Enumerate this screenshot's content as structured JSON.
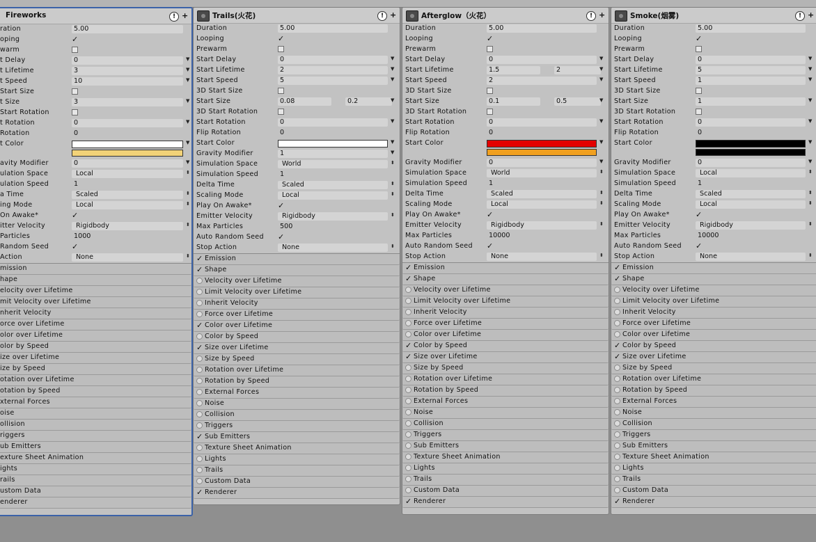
{
  "colors": {
    "panel_bg": "#c2c2c2",
    "selected_border": "#3b62a8",
    "background": "#8f8f8f"
  },
  "check_glyph": "✓",
  "panels": [
    {
      "title": "Fireworks",
      "selected": true,
      "props": [
        {
          "label": "ration",
          "type": "field",
          "value": "5.00"
        },
        {
          "label": "oping",
          "type": "check",
          "checked": true
        },
        {
          "label": "warm",
          "type": "check",
          "checked": false
        },
        {
          "label": "t Delay",
          "type": "field",
          "value": "0",
          "dropdown": true
        },
        {
          "label": "t Lifetime",
          "type": "field",
          "value": "3",
          "dropdown": true
        },
        {
          "label": "t Speed",
          "type": "field",
          "value": "10",
          "dropdown": true
        },
        {
          "label": "Start Size",
          "type": "check",
          "checked": false
        },
        {
          "label": "t Size",
          "type": "field",
          "value": "3",
          "dropdown": true
        },
        {
          "label": "Start Rotation",
          "type": "check",
          "checked": false
        },
        {
          "label": "t Rotation",
          "type": "field",
          "value": "0",
          "dropdown": true
        },
        {
          "label": "Rotation",
          "type": "field",
          "value": "0",
          "plain": true
        },
        {
          "label": "t Color",
          "type": "color",
          "colors": [
            "#ffffff",
            "#f2d278"
          ],
          "dropdown": true
        },
        {
          "label": "avity Modifier",
          "type": "field",
          "value": "0",
          "dropdown": true
        },
        {
          "label": "ulation Space",
          "type": "select",
          "value": "Local"
        },
        {
          "label": "ulation Speed",
          "type": "field",
          "value": "1",
          "plain": true
        },
        {
          "label": "a Time",
          "type": "select",
          "value": "Scaled"
        },
        {
          "label": "ing Mode",
          "type": "select",
          "value": "Local"
        },
        {
          "label": "On Awake*",
          "type": "check",
          "checked": true
        },
        {
          "label": "itter Velocity",
          "type": "select",
          "value": "Rigidbody"
        },
        {
          "label": "Particles",
          "type": "field",
          "value": "1000",
          "plain": true
        },
        {
          "label": "Random Seed",
          "type": "check",
          "checked": true
        },
        {
          "label": "Action",
          "type": "select",
          "value": "None"
        }
      ],
      "modules": [
        {
          "label": "mission",
          "state": "none"
        },
        {
          "label": "hape",
          "state": "none"
        },
        {
          "label": "elocity over Lifetime",
          "state": "none"
        },
        {
          "label": "mit Velocity over Lifetime",
          "state": "none"
        },
        {
          "label": "nherit Velocity",
          "state": "none"
        },
        {
          "label": "orce over Lifetime",
          "state": "none"
        },
        {
          "label": "olor over Lifetime",
          "state": "none"
        },
        {
          "label": "olor by Speed",
          "state": "none"
        },
        {
          "label": "ize over Lifetime",
          "state": "none"
        },
        {
          "label": "ize by Speed",
          "state": "none"
        },
        {
          "label": "otation over Lifetime",
          "state": "none"
        },
        {
          "label": "otation by Speed",
          "state": "none"
        },
        {
          "label": "xternal Forces",
          "state": "none"
        },
        {
          "label": "oise",
          "state": "none"
        },
        {
          "label": "ollision",
          "state": "none"
        },
        {
          "label": "riggers",
          "state": "none"
        },
        {
          "label": "ub Emitters",
          "state": "none"
        },
        {
          "label": "exture Sheet Animation",
          "state": "none"
        },
        {
          "label": "ights",
          "state": "none"
        },
        {
          "label": "rails",
          "state": "none"
        },
        {
          "label": "ustom Data",
          "state": "none"
        },
        {
          "label": "enderer",
          "state": "none"
        }
      ]
    },
    {
      "title": "Trails(火花)",
      "selected": false,
      "props": [
        {
          "label": "Duration",
          "type": "field",
          "value": "5.00"
        },
        {
          "label": "Looping",
          "type": "check",
          "checked": true
        },
        {
          "label": "Prewarm",
          "type": "check",
          "checked": false
        },
        {
          "label": "Start Delay",
          "type": "field",
          "value": "0",
          "dropdown": true
        },
        {
          "label": "Start Lifetime",
          "type": "field",
          "value": "2",
          "dropdown": true
        },
        {
          "label": "Start Speed",
          "type": "field",
          "value": "5",
          "dropdown": true
        },
        {
          "label": "3D Start Size",
          "type": "check",
          "checked": false
        },
        {
          "label": "Start Size",
          "type": "range",
          "value": "0.08",
          "value2": "0.2",
          "dropdown": true
        },
        {
          "label": "3D Start Rotation",
          "type": "check",
          "checked": false
        },
        {
          "label": "Start Rotation",
          "type": "field",
          "value": "0",
          "dropdown": true
        },
        {
          "label": "Flip Rotation",
          "type": "field",
          "value": "0",
          "plain": true
        },
        {
          "label": "Start Color",
          "type": "color",
          "colors": [
            "#ffffff"
          ],
          "dropdown": true
        },
        {
          "label": "Gravity Modifier",
          "type": "field",
          "value": "1",
          "dropdown": true
        },
        {
          "label": "Simulation Space",
          "type": "select",
          "value": "World"
        },
        {
          "label": "Simulation Speed",
          "type": "field",
          "value": "1",
          "plain": true
        },
        {
          "label": "Delta Time",
          "type": "select",
          "value": "Scaled"
        },
        {
          "label": "Scaling Mode",
          "type": "select",
          "value": "Local"
        },
        {
          "label": "Play On Awake*",
          "type": "check",
          "checked": true
        },
        {
          "label": "Emitter Velocity",
          "type": "select",
          "value": "Rigidbody"
        },
        {
          "label": "Max Particles",
          "type": "field",
          "value": "500",
          "plain": true
        },
        {
          "label": "Auto Random Seed",
          "type": "check",
          "checked": true
        },
        {
          "label": "Stop Action",
          "type": "select",
          "value": "None"
        }
      ],
      "modules": [
        {
          "label": "Emission",
          "state": "on"
        },
        {
          "label": "Shape",
          "state": "on"
        },
        {
          "label": "Velocity over Lifetime",
          "state": "off"
        },
        {
          "label": "Limit Velocity over Lifetime",
          "state": "off"
        },
        {
          "label": "Inherit Velocity",
          "state": "off"
        },
        {
          "label": "Force over Lifetime",
          "state": "off"
        },
        {
          "label": "Color over Lifetime",
          "state": "on"
        },
        {
          "label": "Color by Speed",
          "state": "off"
        },
        {
          "label": "Size over Lifetime",
          "state": "on"
        },
        {
          "label": "Size by Speed",
          "state": "off"
        },
        {
          "label": "Rotation over Lifetime",
          "state": "off"
        },
        {
          "label": "Rotation by Speed",
          "state": "off"
        },
        {
          "label": "External Forces",
          "state": "off"
        },
        {
          "label": "Noise",
          "state": "off"
        },
        {
          "label": "Collision",
          "state": "off"
        },
        {
          "label": "Triggers",
          "state": "off"
        },
        {
          "label": "Sub Emitters",
          "state": "on"
        },
        {
          "label": "Texture Sheet Animation",
          "state": "off"
        },
        {
          "label": "Lights",
          "state": "off"
        },
        {
          "label": "Trails",
          "state": "off"
        },
        {
          "label": "Custom Data",
          "state": "off"
        },
        {
          "label": "Renderer",
          "state": "on"
        }
      ]
    },
    {
      "title": "Afterglow（火花）",
      "selected": false,
      "props": [
        {
          "label": "Duration",
          "type": "field",
          "value": "5.00"
        },
        {
          "label": "Looping",
          "type": "check",
          "checked": true
        },
        {
          "label": "Prewarm",
          "type": "check",
          "checked": false
        },
        {
          "label": "Start Delay",
          "type": "field",
          "value": "0",
          "dropdown": true
        },
        {
          "label": "Start Lifetime",
          "type": "range",
          "value": "1.5",
          "value2": "2",
          "dropdown": true
        },
        {
          "label": "Start Speed",
          "type": "field",
          "value": "2",
          "dropdown": true
        },
        {
          "label": "3D Start Size",
          "type": "check",
          "checked": false
        },
        {
          "label": "Start Size",
          "type": "range",
          "value": "0.1",
          "value2": "0.5",
          "dropdown": true
        },
        {
          "label": "3D Start Rotation",
          "type": "check",
          "checked": false
        },
        {
          "label": "Start Rotation",
          "type": "field",
          "value": "0",
          "dropdown": true
        },
        {
          "label": "Flip Rotation",
          "type": "field",
          "value": "0",
          "plain": true
        },
        {
          "label": "Start Color",
          "type": "color",
          "colors": [
            "#e30000",
            "#f0a020"
          ],
          "dropdown": true
        },
        {
          "label": "Gravity Modifier",
          "type": "field",
          "value": "0",
          "dropdown": true
        },
        {
          "label": "Simulation Space",
          "type": "select",
          "value": "World"
        },
        {
          "label": "Simulation Speed",
          "type": "field",
          "value": "1",
          "plain": true
        },
        {
          "label": "Delta Time",
          "type": "select",
          "value": "Scaled"
        },
        {
          "label": "Scaling Mode",
          "type": "select",
          "value": "Local"
        },
        {
          "label": "Play On Awake*",
          "type": "check",
          "checked": true
        },
        {
          "label": "Emitter Velocity",
          "type": "select",
          "value": "Rigidbody"
        },
        {
          "label": "Max Particles",
          "type": "field",
          "value": "10000",
          "plain": true
        },
        {
          "label": "Auto Random Seed",
          "type": "check",
          "checked": true
        },
        {
          "label": "Stop Action",
          "type": "select",
          "value": "None"
        }
      ],
      "modules": [
        {
          "label": "Emission",
          "state": "on"
        },
        {
          "label": "Shape",
          "state": "on"
        },
        {
          "label": "Velocity over Lifetime",
          "state": "off"
        },
        {
          "label": "Limit Velocity over Lifetime",
          "state": "off"
        },
        {
          "label": "Inherit Velocity",
          "state": "off"
        },
        {
          "label": "Force over Lifetime",
          "state": "off"
        },
        {
          "label": "Color over Lifetime",
          "state": "off"
        },
        {
          "label": "Color by Speed",
          "state": "on"
        },
        {
          "label": "Size over Lifetime",
          "state": "on"
        },
        {
          "label": "Size by Speed",
          "state": "off"
        },
        {
          "label": "Rotation over Lifetime",
          "state": "off"
        },
        {
          "label": "Rotation by Speed",
          "state": "off"
        },
        {
          "label": "External Forces",
          "state": "off"
        },
        {
          "label": "Noise",
          "state": "off"
        },
        {
          "label": "Collision",
          "state": "off"
        },
        {
          "label": "Triggers",
          "state": "off"
        },
        {
          "label": "Sub Emitters",
          "state": "off"
        },
        {
          "label": "Texture Sheet Animation",
          "state": "off"
        },
        {
          "label": "Lights",
          "state": "off"
        },
        {
          "label": "Trails",
          "state": "off"
        },
        {
          "label": "Custom Data",
          "state": "off"
        },
        {
          "label": "Renderer",
          "state": "on"
        }
      ]
    },
    {
      "title": "Smoke(烟雾)",
      "selected": false,
      "props": [
        {
          "label": "Duration",
          "type": "field",
          "value": "5.00"
        },
        {
          "label": "Looping",
          "type": "check",
          "checked": true
        },
        {
          "label": "Prewarm",
          "type": "check",
          "checked": false
        },
        {
          "label": "Start Delay",
          "type": "field",
          "value": "0",
          "dropdown": true
        },
        {
          "label": "Start Lifetime",
          "type": "field",
          "value": "5",
          "dropdown": true
        },
        {
          "label": "Start Speed",
          "type": "field",
          "value": "1",
          "dropdown": true
        },
        {
          "label": "3D Start Size",
          "type": "check",
          "checked": false
        },
        {
          "label": "Start Size",
          "type": "field",
          "value": "1",
          "dropdown": true
        },
        {
          "label": "3D Start Rotation",
          "type": "check",
          "checked": false
        },
        {
          "label": "Start Rotation",
          "type": "field",
          "value": "0",
          "dropdown": true
        },
        {
          "label": "Flip Rotation",
          "type": "field",
          "value": "0",
          "plain": true
        },
        {
          "label": "Start Color",
          "type": "color",
          "colors": [
            "#000000",
            "#000000"
          ],
          "dropdown": true
        },
        {
          "label": "Gravity Modifier",
          "type": "field",
          "value": "0",
          "dropdown": true
        },
        {
          "label": "Simulation Space",
          "type": "select",
          "value": "Local"
        },
        {
          "label": "Simulation Speed",
          "type": "field",
          "value": "1",
          "plain": true
        },
        {
          "label": "Delta Time",
          "type": "select",
          "value": "Scaled"
        },
        {
          "label": "Scaling Mode",
          "type": "select",
          "value": "Local"
        },
        {
          "label": "Play On Awake*",
          "type": "check",
          "checked": true
        },
        {
          "label": "Emitter Velocity",
          "type": "select",
          "value": "Rigidbody"
        },
        {
          "label": "Max Particles",
          "type": "field",
          "value": "10000",
          "plain": true
        },
        {
          "label": "Auto Random Seed",
          "type": "check",
          "checked": true
        },
        {
          "label": "Stop Action",
          "type": "select",
          "value": "None"
        }
      ],
      "modules": [
        {
          "label": "Emission",
          "state": "on"
        },
        {
          "label": "Shape",
          "state": "on"
        },
        {
          "label": "Velocity over Lifetime",
          "state": "off"
        },
        {
          "label": "Limit Velocity over Lifetime",
          "state": "off"
        },
        {
          "label": "Inherit Velocity",
          "state": "off"
        },
        {
          "label": "Force over Lifetime",
          "state": "off"
        },
        {
          "label": "Color over Lifetime",
          "state": "off"
        },
        {
          "label": "Color by Speed",
          "state": "on"
        },
        {
          "label": "Size over Lifetime",
          "state": "on"
        },
        {
          "label": "Size by Speed",
          "state": "off"
        },
        {
          "label": "Rotation over Lifetime",
          "state": "off"
        },
        {
          "label": "Rotation by Speed",
          "state": "off"
        },
        {
          "label": "External Forces",
          "state": "off"
        },
        {
          "label": "Noise",
          "state": "off"
        },
        {
          "label": "Collision",
          "state": "off"
        },
        {
          "label": "Triggers",
          "state": "off"
        },
        {
          "label": "Sub Emitters",
          "state": "off"
        },
        {
          "label": "Texture Sheet Animation",
          "state": "off"
        },
        {
          "label": "Lights",
          "state": "off"
        },
        {
          "label": "Trails",
          "state": "off"
        },
        {
          "label": "Custom Data",
          "state": "off"
        },
        {
          "label": "Renderer",
          "state": "on"
        }
      ]
    }
  ]
}
